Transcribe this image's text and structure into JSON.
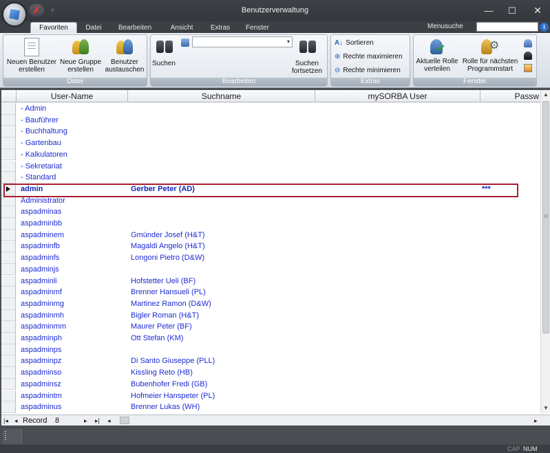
{
  "window": {
    "title": "Benutzerverwaltung",
    "min": "—",
    "max": "☐",
    "close": "✕"
  },
  "qat": {
    "close_glyph": "✗",
    "dropdown_glyph": "▿"
  },
  "tabs": [
    "Favoriten",
    "Datei",
    "Bearbeiten",
    "Ansicht",
    "Extras",
    "Fenster"
  ],
  "menusuche": {
    "label": "Menusuche",
    "value": "",
    "help": "i"
  },
  "ribbon": {
    "datei": {
      "caption": "Datei",
      "buttons": [
        "Neuen Benutzer erstellen",
        "Neue Gruppe erstellen",
        "Benutzer austauschen"
      ]
    },
    "bearbeiten": {
      "caption": "Bearbeiten",
      "suchen": "Suchen",
      "suchen_fortsetzen": "Suchen fortsetzen",
      "combo_value": ""
    },
    "extras": {
      "caption": "Extras",
      "items": [
        "Sortieren",
        "Rechte maximieren",
        "Rechte minimieren"
      ]
    },
    "fenster": {
      "caption": "Fenster",
      "buttons": [
        "Aktuelle Rolle verteilen",
        "Rolle für nächsten Programmstart"
      ]
    }
  },
  "grid": {
    "columns": [
      "User-Name",
      "Suchname",
      "mySORBA User",
      "Passw"
    ],
    "rows": [
      {
        "user": "- Admin",
        "suchname": "",
        "sorba": "",
        "passw": ""
      },
      {
        "user": "- Bauführer",
        "suchname": "",
        "sorba": "",
        "passw": ""
      },
      {
        "user": "- Buchhaltung",
        "suchname": "",
        "sorba": "",
        "passw": ""
      },
      {
        "user": "- Gartenbau",
        "suchname": "",
        "sorba": "",
        "passw": ""
      },
      {
        "user": "- Kalkulatoren",
        "suchname": "",
        "sorba": "",
        "passw": ""
      },
      {
        "user": "- Sekretariat",
        "suchname": "",
        "sorba": "",
        "passw": ""
      },
      {
        "user": "- Standard",
        "suchname": "",
        "sorba": "",
        "passw": ""
      },
      {
        "user": "admin",
        "suchname": "Gerber Peter (AD)",
        "sorba": "***",
        "passw": "",
        "selected": true
      },
      {
        "user": "Administrator",
        "suchname": "",
        "sorba": "",
        "passw": ""
      },
      {
        "user": "aspadminas",
        "suchname": "",
        "sorba": "",
        "passw": ""
      },
      {
        "user": "aspadminbb",
        "suchname": "",
        "sorba": "",
        "passw": ""
      },
      {
        "user": "aspadminem",
        "suchname": "Gmünder Josef (H&T)",
        "sorba": "",
        "passw": ""
      },
      {
        "user": "aspadminfb",
        "suchname": "Magaldi Angelo (H&T)",
        "sorba": "",
        "passw": ""
      },
      {
        "user": "aspadminfs",
        "suchname": "Longoni Pietro (D&W)",
        "sorba": "",
        "passw": ""
      },
      {
        "user": "aspadminjs",
        "suchname": "",
        "sorba": "",
        "passw": ""
      },
      {
        "user": "aspadminli",
        "suchname": "Hofstetter Ueli (BF)",
        "sorba": "",
        "passw": ""
      },
      {
        "user": "aspadminmf",
        "suchname": "Brenner Hansueli (PL)",
        "sorba": "",
        "passw": ""
      },
      {
        "user": "aspadminmg",
        "suchname": "Martinez Ramon (D&W)",
        "sorba": "",
        "passw": ""
      },
      {
        "user": "aspadminmh",
        "suchname": "Bigler Roman (H&T)",
        "sorba": "",
        "passw": ""
      },
      {
        "user": "aspadminmm",
        "suchname": "Maurer Peter (BF)",
        "sorba": "",
        "passw": ""
      },
      {
        "user": "aspadminph",
        "suchname": "Ott Stefan (KM)",
        "sorba": "",
        "passw": ""
      },
      {
        "user": "aspadminps",
        "suchname": "",
        "sorba": "",
        "passw": ""
      },
      {
        "user": "aspadminpz",
        "suchname": "Di Santo Giuseppe (PLL)",
        "sorba": "",
        "passw": ""
      },
      {
        "user": "aspadminso",
        "suchname": "Kissling Reto (HB)",
        "sorba": "",
        "passw": ""
      },
      {
        "user": "aspadminsz",
        "suchname": "Bubenhofer Fredi (GB)",
        "sorba": "",
        "passw": ""
      },
      {
        "user": "aspadmintm",
        "suchname": "Hofmeier Hanspeter (PL)",
        "sorba": "",
        "passw": ""
      },
      {
        "user": "aspadminus",
        "suchname": "Brenner Lukas (WH)",
        "sorba": "",
        "passw": ""
      }
    ]
  },
  "navigator": {
    "label": "Record",
    "value": "8",
    "first": "|◂",
    "prev": "◂",
    "next": "▸",
    "last": "▸|",
    "new": "▸*"
  },
  "status": {
    "cap": "CAP",
    "num": "NUM"
  },
  "colors": {
    "link": "#1d2bd1",
    "selection_border": "#a8202f"
  }
}
